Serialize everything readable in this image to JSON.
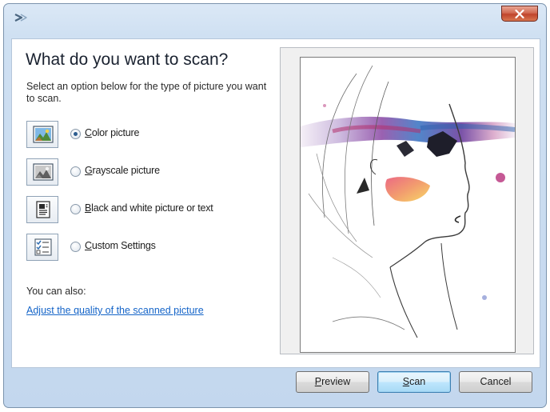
{
  "window": {
    "close_icon": "close-icon",
    "app_icon": "scanner-arrow-icon",
    "close_color": "#c0442c"
  },
  "main": {
    "heading": "What do you want to scan?",
    "instructions": "Select an option below for the type of picture you want to scan."
  },
  "options": [
    {
      "icon": "color-picture-icon",
      "mnemonic": "C",
      "rest": "olor picture",
      "selected": true
    },
    {
      "icon": "grayscale-picture-icon",
      "mnemonic": "G",
      "rest": "rayscale picture",
      "selected": false
    },
    {
      "icon": "black-white-document-icon",
      "mnemonic": "B",
      "rest": "lack and white picture or text",
      "selected": false
    },
    {
      "icon": "custom-settings-icon",
      "mnemonic": "C",
      "rest": "ustom Settings",
      "selected": false
    }
  ],
  "also": {
    "label": "You can also:",
    "link": "Adjust the quality of the scanned picture"
  },
  "preview": {
    "image": "watercolor-woman-portrait-sketch"
  },
  "buttons": {
    "preview": {
      "mnemonic": "P",
      "rest": "review"
    },
    "scan": {
      "mnemonic": "S",
      "rest": "can"
    },
    "cancel": {
      "label": "Cancel"
    }
  },
  "colors": {
    "link": "#1464c8",
    "radio_selected": "#2c5c8e",
    "default_button_border": "#3c7fb1"
  }
}
